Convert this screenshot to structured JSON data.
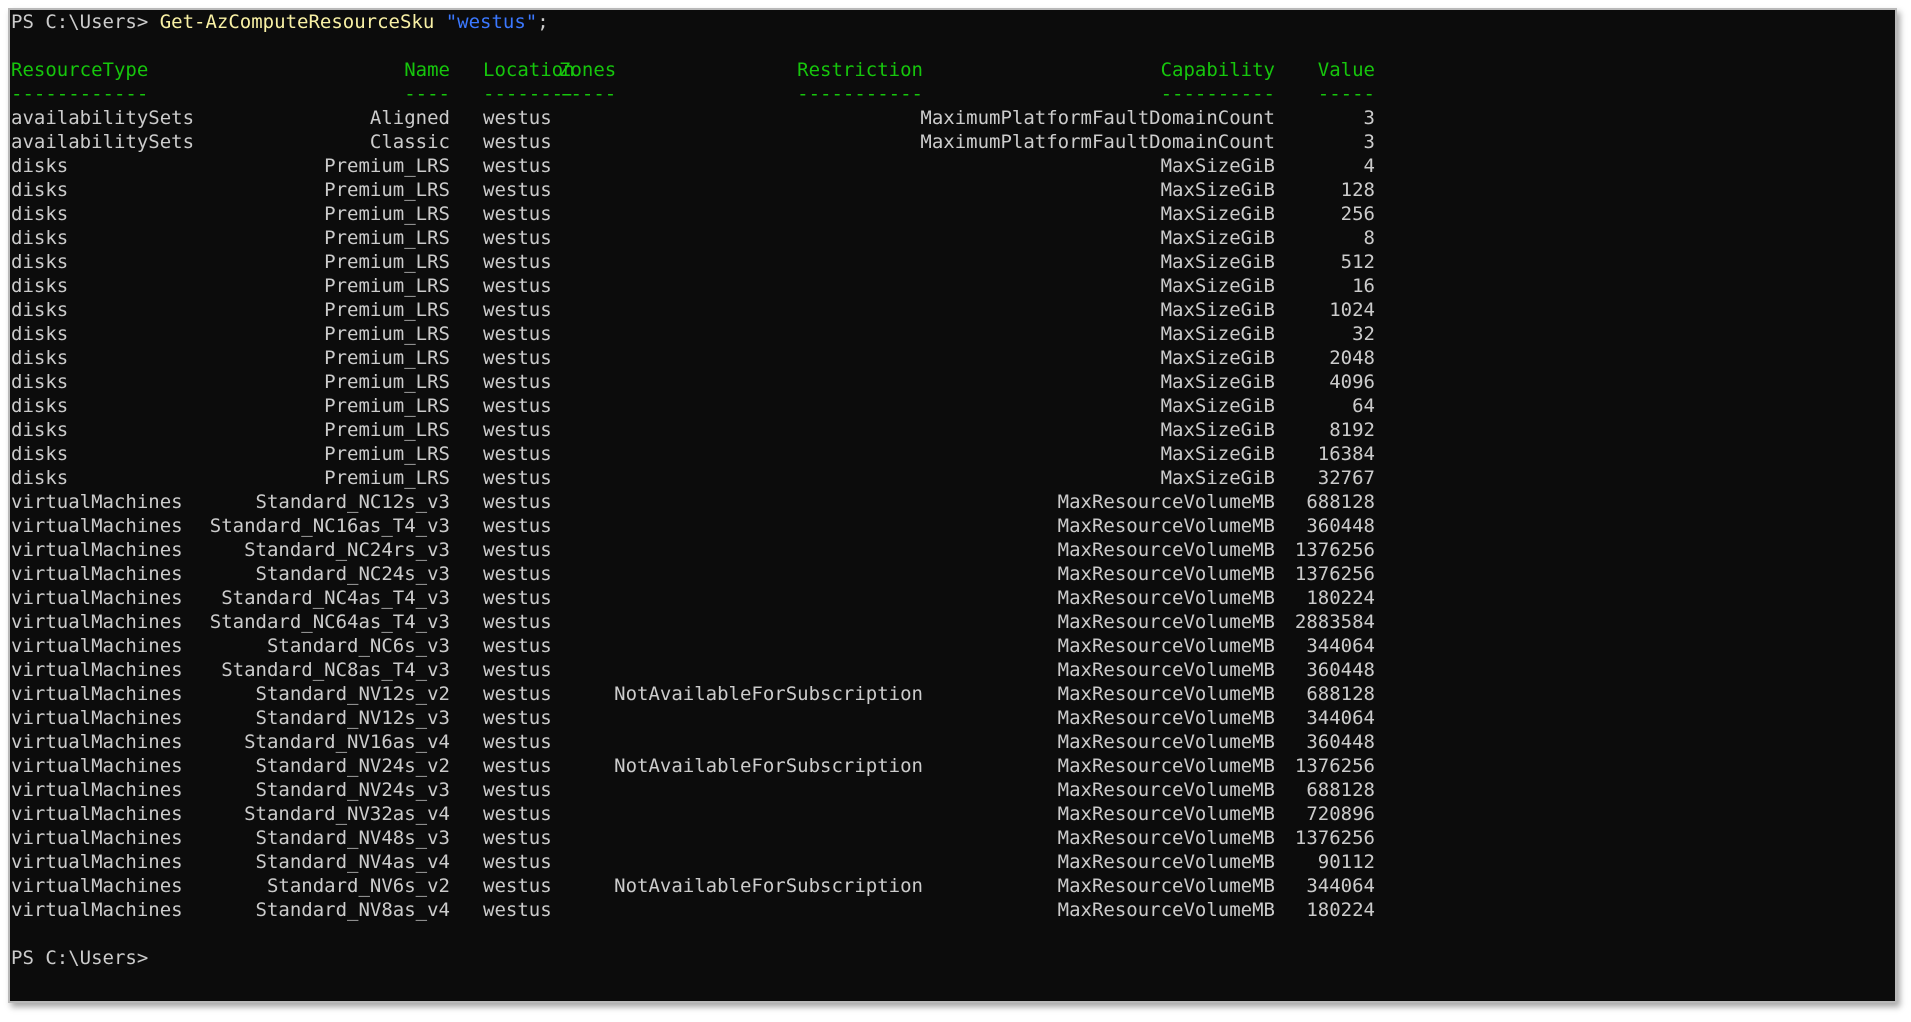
{
  "console": {
    "prompt1": "PS C:\\Users>",
    "command": "Get-AzComputeResourceSku",
    "argument": "\"westus\"",
    "terminator": ";",
    "prompt2": "PS C:\\Users>"
  },
  "headers": {
    "resource_type": "ResourceType",
    "name": "Name",
    "location": "Location",
    "zones": "Zones",
    "restriction": "Restriction",
    "capability": "Capability",
    "value": "Value"
  },
  "underlines": {
    "resource_type": "------------",
    "name": "----",
    "location": "--------",
    "zones": "-----",
    "restriction": "-----------",
    "capability": "----------",
    "value": "-----"
  },
  "rows": [
    {
      "type": "availabilitySets",
      "name": "Aligned",
      "location": "westus",
      "zones": "",
      "restriction": "",
      "capability": "MaximumPlatformFaultDomainCount",
      "value": "3"
    },
    {
      "type": "availabilitySets",
      "name": "Classic",
      "location": "westus",
      "zones": "",
      "restriction": "",
      "capability": "MaximumPlatformFaultDomainCount",
      "value": "3"
    },
    {
      "type": "disks",
      "name": "Premium_LRS",
      "location": "westus",
      "zones": "",
      "restriction": "",
      "capability": "MaxSizeGiB",
      "value": "4"
    },
    {
      "type": "disks",
      "name": "Premium_LRS",
      "location": "westus",
      "zones": "",
      "restriction": "",
      "capability": "MaxSizeGiB",
      "value": "128"
    },
    {
      "type": "disks",
      "name": "Premium_LRS",
      "location": "westus",
      "zones": "",
      "restriction": "",
      "capability": "MaxSizeGiB",
      "value": "256"
    },
    {
      "type": "disks",
      "name": "Premium_LRS",
      "location": "westus",
      "zones": "",
      "restriction": "",
      "capability": "MaxSizeGiB",
      "value": "8"
    },
    {
      "type": "disks",
      "name": "Premium_LRS",
      "location": "westus",
      "zones": "",
      "restriction": "",
      "capability": "MaxSizeGiB",
      "value": "512"
    },
    {
      "type": "disks",
      "name": "Premium_LRS",
      "location": "westus",
      "zones": "",
      "restriction": "",
      "capability": "MaxSizeGiB",
      "value": "16"
    },
    {
      "type": "disks",
      "name": "Premium_LRS",
      "location": "westus",
      "zones": "",
      "restriction": "",
      "capability": "MaxSizeGiB",
      "value": "1024"
    },
    {
      "type": "disks",
      "name": "Premium_LRS",
      "location": "westus",
      "zones": "",
      "restriction": "",
      "capability": "MaxSizeGiB",
      "value": "32"
    },
    {
      "type": "disks",
      "name": "Premium_LRS",
      "location": "westus",
      "zones": "",
      "restriction": "",
      "capability": "MaxSizeGiB",
      "value": "2048"
    },
    {
      "type": "disks",
      "name": "Premium_LRS",
      "location": "westus",
      "zones": "",
      "restriction": "",
      "capability": "MaxSizeGiB",
      "value": "4096"
    },
    {
      "type": "disks",
      "name": "Premium_LRS",
      "location": "westus",
      "zones": "",
      "restriction": "",
      "capability": "MaxSizeGiB",
      "value": "64"
    },
    {
      "type": "disks",
      "name": "Premium_LRS",
      "location": "westus",
      "zones": "",
      "restriction": "",
      "capability": "MaxSizeGiB",
      "value": "8192"
    },
    {
      "type": "disks",
      "name": "Premium_LRS",
      "location": "westus",
      "zones": "",
      "restriction": "",
      "capability": "MaxSizeGiB",
      "value": "16384"
    },
    {
      "type": "disks",
      "name": "Premium_LRS",
      "location": "westus",
      "zones": "",
      "restriction": "",
      "capability": "MaxSizeGiB",
      "value": "32767"
    },
    {
      "type": "virtualMachines",
      "name": "Standard_NC12s_v3",
      "location": "westus",
      "zones": "",
      "restriction": "",
      "capability": "MaxResourceVolumeMB",
      "value": "688128"
    },
    {
      "type": "virtualMachines",
      "name": "Standard_NC16as_T4_v3",
      "location": "westus",
      "zones": "",
      "restriction": "",
      "capability": "MaxResourceVolumeMB",
      "value": "360448"
    },
    {
      "type": "virtualMachines",
      "name": "Standard_NC24rs_v3",
      "location": "westus",
      "zones": "",
      "restriction": "",
      "capability": "MaxResourceVolumeMB",
      "value": "1376256"
    },
    {
      "type": "virtualMachines",
      "name": "Standard_NC24s_v3",
      "location": "westus",
      "zones": "",
      "restriction": "",
      "capability": "MaxResourceVolumeMB",
      "value": "1376256"
    },
    {
      "type": "virtualMachines",
      "name": "Standard_NC4as_T4_v3",
      "location": "westus",
      "zones": "",
      "restriction": "",
      "capability": "MaxResourceVolumeMB",
      "value": "180224"
    },
    {
      "type": "virtualMachines",
      "name": "Standard_NC64as_T4_v3",
      "location": "westus",
      "zones": "",
      "restriction": "",
      "capability": "MaxResourceVolumeMB",
      "value": "2883584"
    },
    {
      "type": "virtualMachines",
      "name": "Standard_NC6s_v3",
      "location": "westus",
      "zones": "",
      "restriction": "",
      "capability": "MaxResourceVolumeMB",
      "value": "344064"
    },
    {
      "type": "virtualMachines",
      "name": "Standard_NC8as_T4_v3",
      "location": "westus",
      "zones": "",
      "restriction": "",
      "capability": "MaxResourceVolumeMB",
      "value": "360448"
    },
    {
      "type": "virtualMachines",
      "name": "Standard_NV12s_v2",
      "location": "westus",
      "zones": "",
      "restriction": "NotAvailableForSubscription",
      "capability": "MaxResourceVolumeMB",
      "value": "688128"
    },
    {
      "type": "virtualMachines",
      "name": "Standard_NV12s_v3",
      "location": "westus",
      "zones": "",
      "restriction": "",
      "capability": "MaxResourceVolumeMB",
      "value": "344064"
    },
    {
      "type": "virtualMachines",
      "name": "Standard_NV16as_v4",
      "location": "westus",
      "zones": "",
      "restriction": "",
      "capability": "MaxResourceVolumeMB",
      "value": "360448"
    },
    {
      "type": "virtualMachines",
      "name": "Standard_NV24s_v2",
      "location": "westus",
      "zones": "",
      "restriction": "NotAvailableForSubscription",
      "capability": "MaxResourceVolumeMB",
      "value": "1376256"
    },
    {
      "type": "virtualMachines",
      "name": "Standard_NV24s_v3",
      "location": "westus",
      "zones": "",
      "restriction": "",
      "capability": "MaxResourceVolumeMB",
      "value": "688128"
    },
    {
      "type": "virtualMachines",
      "name": "Standard_NV32as_v4",
      "location": "westus",
      "zones": "",
      "restriction": "",
      "capability": "MaxResourceVolumeMB",
      "value": "720896"
    },
    {
      "type": "virtualMachines",
      "name": "Standard_NV48s_v3",
      "location": "westus",
      "zones": "",
      "restriction": "",
      "capability": "MaxResourceVolumeMB",
      "value": "1376256"
    },
    {
      "type": "virtualMachines",
      "name": "Standard_NV4as_v4",
      "location": "westus",
      "zones": "",
      "restriction": "",
      "capability": "MaxResourceVolumeMB",
      "value": "90112"
    },
    {
      "type": "virtualMachines",
      "name": "Standard_NV6s_v2",
      "location": "westus",
      "zones": "",
      "restriction": "NotAvailableForSubscription",
      "capability": "MaxResourceVolumeMB",
      "value": "344064"
    },
    {
      "type": "virtualMachines",
      "name": "Standard_NV8as_v4",
      "location": "westus",
      "zones": "",
      "restriction": "",
      "capability": "MaxResourceVolumeMB",
      "value": "180224"
    }
  ],
  "colors": {
    "background": "#0c0c0c",
    "foreground": "#cccccc",
    "command": "#f9f1a5",
    "string": "#3b78ff",
    "header": "#16c60c"
  }
}
